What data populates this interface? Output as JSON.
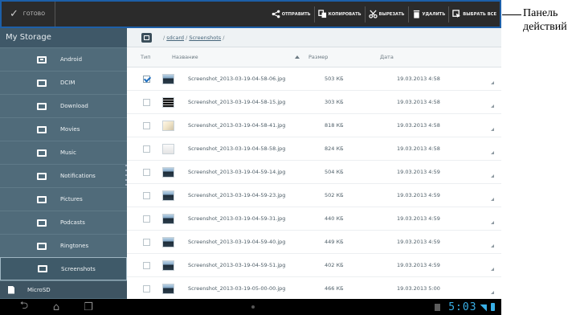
{
  "action_bar": {
    "done_label": "ГОТОВО",
    "actions": [
      {
        "icon": "share-icon",
        "label": "ОТПРАВИТЬ"
      },
      {
        "icon": "copy-icon",
        "label": "КОПИРОВАТЬ"
      },
      {
        "icon": "scissors-icon",
        "label": "ВЫРЕЗАТЬ"
      },
      {
        "icon": "trash-icon",
        "label": "УДАЛИТЬ"
      },
      {
        "icon": "select-all-icon",
        "label": "ВЫБРАТЬ ВСЕ"
      }
    ]
  },
  "sidebar": {
    "title": "My Storage",
    "items": [
      {
        "label": "Android",
        "selected": false
      },
      {
        "label": "DCIM",
        "selected": false
      },
      {
        "label": "Download",
        "selected": false
      },
      {
        "label": "Movies",
        "selected": false
      },
      {
        "label": "Music",
        "selected": false
      },
      {
        "label": "Notifications",
        "selected": false
      },
      {
        "label": "Pictures",
        "selected": false
      },
      {
        "label": "Podcasts",
        "selected": false
      },
      {
        "label": "Ringtones",
        "selected": false
      },
      {
        "label": "Screenshots",
        "selected": true
      }
    ],
    "microsd_label": "MicroSD"
  },
  "path": {
    "prefix": "/ ",
    "segment1": "sdcard",
    "sep": " / ",
    "segment2": "Screenshots",
    "suffix": " /"
  },
  "table": {
    "headers": {
      "type": "Тип",
      "name": "Название",
      "size": "Размер",
      "date": "Дата"
    },
    "rows": [
      {
        "checked": true,
        "thumb": "dark",
        "name": "Screenshot_2013-03-19-04-58-06.jpg",
        "size": "503 КБ",
        "date": "19.03.2013 4:58"
      },
      {
        "checked": false,
        "thumb": "grid",
        "name": "Screenshot_2013-03-19-04-58-15.jpg",
        "size": "303 КБ",
        "date": "19.03.2013 4:58"
      },
      {
        "checked": false,
        "thumb": "light",
        "name": "Screenshot_2013-03-19-04-58-41.jpg",
        "size": "818 КБ",
        "date": "19.03.2013 4:58"
      },
      {
        "checked": false,
        "thumb": "white",
        "name": "Screenshot_2013-03-19-04-58-58.jpg",
        "size": "824 КБ",
        "date": "19.03.2013 4:58"
      },
      {
        "checked": false,
        "thumb": "dark",
        "name": "Screenshot_2013-03-19-04-59-14.jpg",
        "size": "504 КБ",
        "date": "19.03.2013 4:59"
      },
      {
        "checked": false,
        "thumb": "dark",
        "name": "Screenshot_2013-03-19-04-59-23.jpg",
        "size": "502 КБ",
        "date": "19.03.2013 4:59"
      },
      {
        "checked": false,
        "thumb": "dark",
        "name": "Screenshot_2013-03-19-04-59-31.jpg",
        "size": "440 КБ",
        "date": "19.03.2013 4:59"
      },
      {
        "checked": false,
        "thumb": "dark",
        "name": "Screenshot_2013-03-19-04-59-40.jpg",
        "size": "449 КБ",
        "date": "19.03.2013 4:59"
      },
      {
        "checked": false,
        "thumb": "dark",
        "name": "Screenshot_2013-03-19-04-59-51.jpg",
        "size": "402 КБ",
        "date": "19.03.2013 4:59"
      },
      {
        "checked": false,
        "thumb": "dark",
        "name": "Screenshot_2013-03-19-05-00-00.jpg",
        "size": "466 КБ",
        "date": "19.03.2013 5:00"
      }
    ]
  },
  "status_bar": {
    "time": "5:03"
  },
  "callout": {
    "text": "Панель\nдействий"
  },
  "colors": {
    "accent": "#39b0e8",
    "sidebar": "#506b7a",
    "highlight_border": "#1d5fa8"
  }
}
